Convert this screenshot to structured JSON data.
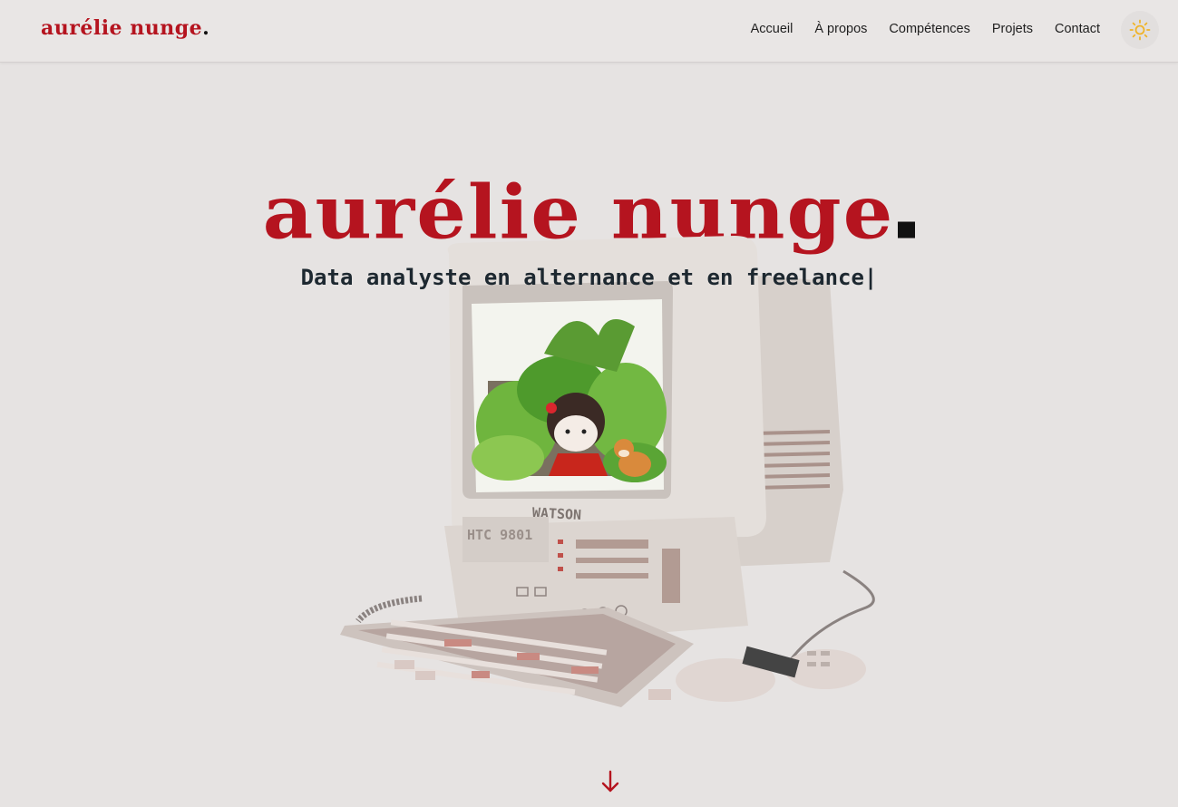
{
  "header": {
    "logo_text": "aurélie nunge",
    "logo_dot": ".",
    "nav": [
      {
        "label": "Accueil"
      },
      {
        "label": "À propos"
      },
      {
        "label": "Compétences"
      },
      {
        "label": "Projets"
      },
      {
        "label": "Contact"
      }
    ],
    "theme_icon": "sun-icon"
  },
  "hero": {
    "title": "aurélie nunge",
    "subtitle": "Data analyste en alternance et en freelance|",
    "computer_brand": "WATSON",
    "computer_model": "HTC 9801"
  },
  "scroll_icon": "arrow-down-icon",
  "colors": {
    "accent": "#b5141f",
    "background": "#e6e3e2",
    "text": "#1d2830"
  }
}
